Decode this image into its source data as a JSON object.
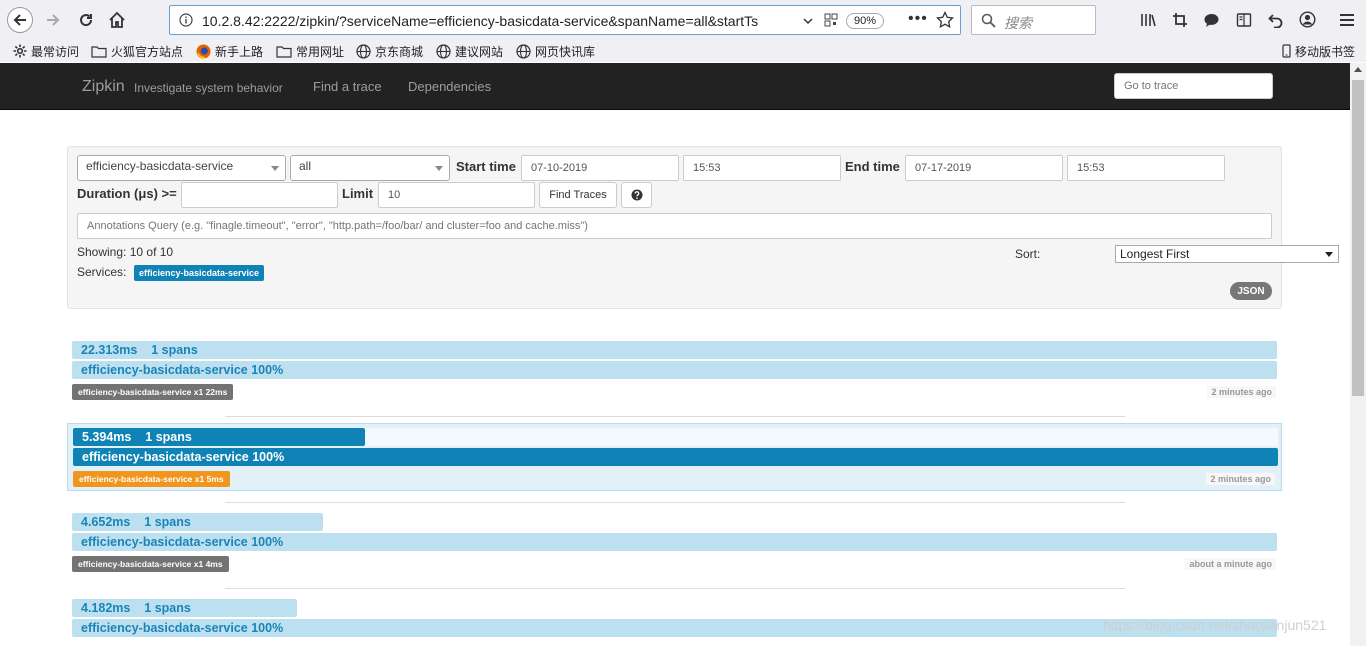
{
  "browser": {
    "url": "10.2.8.42:2222/zipkin/?serviceName=efficiency-basicdata-service&spanName=all&startTs",
    "zoom": "90%",
    "search_placeholder": "搜索",
    "bookmarks": [
      "最常访问",
      "火狐官方站点",
      "新手上路",
      "常用网址",
      "京东商城",
      "建议网站",
      "网页快讯库"
    ],
    "mobile_bookmarks": "移动版书签"
  },
  "app": {
    "brand": "Zipkin",
    "tagline": "Investigate system behavior",
    "nav": [
      "Find a trace",
      "Dependencies"
    ],
    "goto_placeholder": "Go to trace"
  },
  "search": {
    "service": "efficiency-basicdata-service",
    "span": "all",
    "start_label": "Start time",
    "start_date": "07-10-2019",
    "start_time": "15:53",
    "end_label": "End time",
    "end_date": "07-17-2019",
    "end_time": "15:53",
    "duration_label": "Duration (μs) >=",
    "duration_value": "",
    "limit_label": "Limit",
    "limit_value": "10",
    "find_button": "Find Traces",
    "help_icon": "question-circle-icon",
    "annotations_placeholder": "Annotations Query (e.g. \"finagle.timeout\", \"error\", \"http.path=/foo/bar/ and cluster=foo and cache.miss\")",
    "showing_label": "Showing:",
    "showing_value": "10 of 10",
    "services_label": "Services:",
    "service_tag": "efficiency-basicdata-service",
    "sort_label": "Sort:",
    "sort_value": "Longest First",
    "json_button": "JSON"
  },
  "traces": [
    {
      "duration": "22.313ms",
      "spans": "1 spans",
      "service_pct": "efficiency-basicdata-service 100%",
      "tag": "efficiency-basicdata-service x1 22ms",
      "ago": "2 minutes ago",
      "width_pct": 100,
      "highlight": false
    },
    {
      "duration": "5.394ms",
      "spans": "1 spans",
      "service_pct": "efficiency-basicdata-service 100%",
      "tag": "efficiency-basicdata-service x1 5ms",
      "ago": "2 minutes ago",
      "width_pct": 24.2,
      "highlight": true
    },
    {
      "duration": "4.652ms",
      "spans": "1 spans",
      "service_pct": "efficiency-basicdata-service 100%",
      "tag": "efficiency-basicdata-service x1 4ms",
      "ago": "about a minute ago",
      "width_pct": 20.8,
      "highlight": false
    },
    {
      "duration": "4.182ms",
      "spans": "1 spans",
      "service_pct": "efficiency-basicdata-service 100%",
      "tag": "",
      "ago": "",
      "width_pct": 18.7,
      "highlight": false
    }
  ],
  "watermark": "https://blog.csdn.net/shaojianjun521",
  "colors": {
    "navbar": "#222222",
    "accent": "#1083b6",
    "bar_light": "#bde0f0",
    "tag_gray": "#737373",
    "tag_orange": "#f0961e"
  }
}
